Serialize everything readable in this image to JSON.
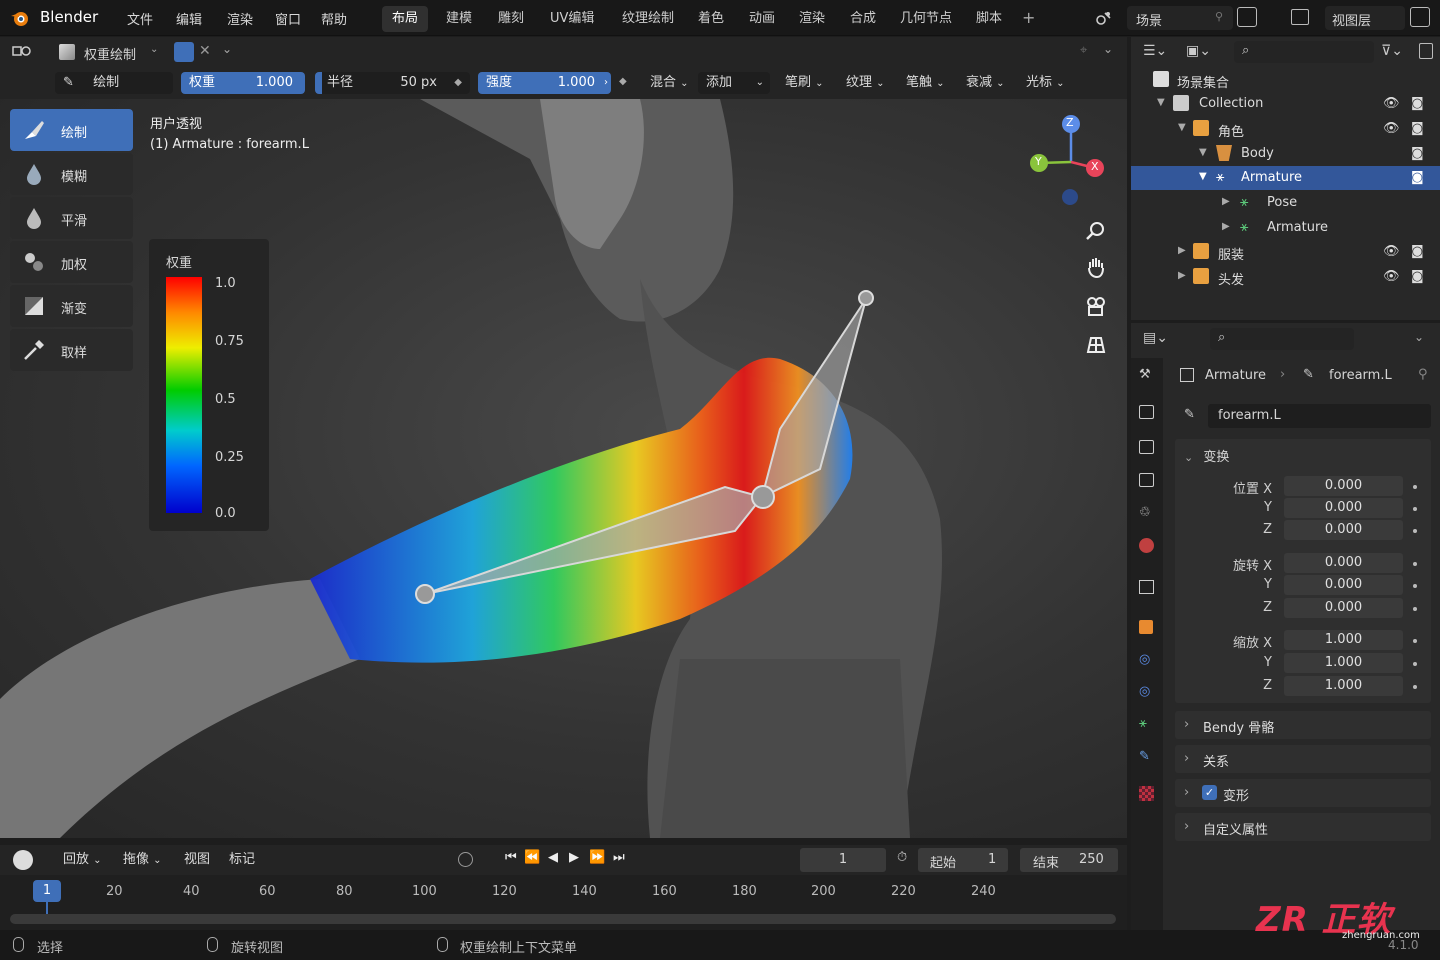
{
  "app": {
    "name": "Blender",
    "version": "4.1.0"
  },
  "menu": [
    "文件",
    "编辑",
    "渲染",
    "窗口",
    "帮助"
  ],
  "workspaces": [
    "布局",
    "建模",
    "雕刻",
    "UV编辑",
    "纹理绘制",
    "着色",
    "动画",
    "渲染",
    "合成",
    "几何节点",
    "脚本"
  ],
  "scene_label": "场景",
  "viewlayer_label": "视图层",
  "viewport": {
    "mode": "权重绘制",
    "tool_name": "绘制",
    "weight_label": "权重",
    "weight_value": "1.000",
    "radius_label": "半径",
    "radius_value": "50 px",
    "strength_label": "强度",
    "strength_value": "1.000",
    "dropdowns": [
      "混合",
      "添加",
      "笔刷",
      "纹理",
      "笔触",
      "衰减",
      "光标"
    ],
    "view_title": "用户透视",
    "view_subtitle": "(1) Armature : forearm.L",
    "tools": [
      "绘制",
      "模糊",
      "平滑",
      "加权",
      "渐变",
      "取样"
    ],
    "legend": {
      "title": "权重",
      "ticks": [
        "1.0",
        "0.75",
        "0.5",
        "0.25",
        "0.0"
      ]
    },
    "gizmo": {
      "x": "X",
      "y": "Y",
      "z": "Z"
    }
  },
  "outliner": {
    "root": "场景集合",
    "rows": [
      {
        "label": "Collection"
      },
      {
        "label": "角色"
      },
      {
        "label": "Body"
      },
      {
        "label": "Armature"
      },
      {
        "label": "Pose"
      },
      {
        "label": "Armature"
      },
      {
        "label": "服装"
      },
      {
        "label": "头发"
      }
    ]
  },
  "properties": {
    "breadcrumb_object": "Armature",
    "breadcrumb_bone": "forearm.L",
    "bone_name": "forearm.L",
    "transform_label": "变换",
    "location_label": "位置",
    "rotation_label": "旋转",
    "scale_label": "缩放",
    "axes": [
      "X",
      "Y",
      "Z"
    ],
    "location": [
      "0.000",
      "0.000",
      "0.000"
    ],
    "rotation": [
      "0.000",
      "0.000",
      "0.000"
    ],
    "scale": [
      "1.000",
      "1.000",
      "1.000"
    ],
    "sections": [
      "Bendy 骨骼",
      "关系",
      "变形",
      "自定义属性"
    ],
    "deform_checked": true
  },
  "timeline": {
    "menus": [
      "回放",
      "拖像",
      "视图",
      "标记"
    ],
    "current_frame": "1",
    "start_label": "起始",
    "start": "1",
    "end_label": "结束",
    "end": "250",
    "ticks": [
      "20",
      "40",
      "60",
      "80",
      "100",
      "120",
      "140",
      "160",
      "180",
      "200",
      "220",
      "240"
    ],
    "playhead": "1"
  },
  "status": {
    "select": "选择",
    "rotate": "旋转视图",
    "context": "权重绘制上下文菜单"
  },
  "watermark": {
    "brand": "ZR 正软",
    "url": "zhengruan.com"
  },
  "colors": {
    "accent": "#3f6fb8",
    "selection": "#33579a",
    "bg": "#1d1d1d"
  }
}
